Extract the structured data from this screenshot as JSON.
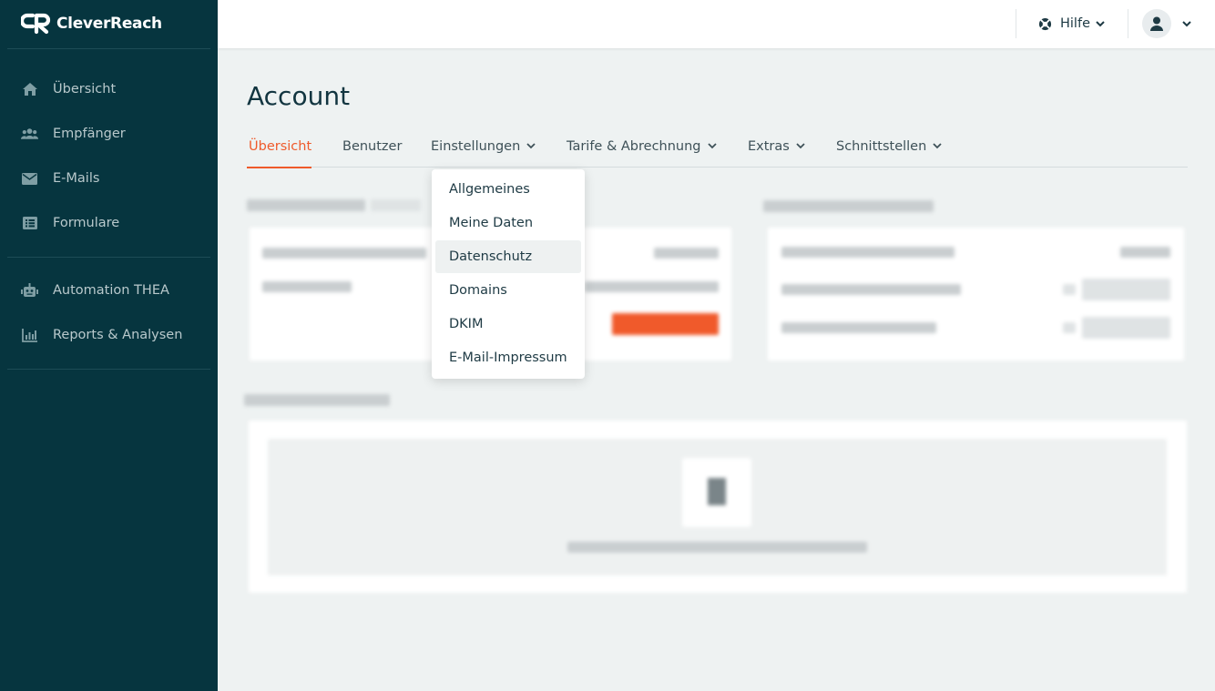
{
  "app": {
    "brand": "CleverReach"
  },
  "sidebar": {
    "items": [
      {
        "label": "Übersicht",
        "icon": "home-icon"
      },
      {
        "label": "Empfänger",
        "icon": "users-icon"
      },
      {
        "label": "E-Mails",
        "icon": "envelope-icon"
      },
      {
        "label": "Formulare",
        "icon": "form-list-icon"
      },
      {
        "label": "Automation THEA",
        "icon": "robot-icon"
      },
      {
        "label": "Reports & Analysen",
        "icon": "bar-chart-icon"
      }
    ]
  },
  "header": {
    "help_label": "Hilfe",
    "help_icon": "lifebuoy-icon",
    "user_icon": "user-icon"
  },
  "page": {
    "title": "Account",
    "tabs": [
      {
        "label": "Übersicht",
        "active": true,
        "has_dropdown": false
      },
      {
        "label": "Benutzer",
        "active": false,
        "has_dropdown": false
      },
      {
        "label": "Einstellungen",
        "active": false,
        "has_dropdown": true
      },
      {
        "label": "Tarife & Abrechnung",
        "active": false,
        "has_dropdown": true
      },
      {
        "label": "Extras",
        "active": false,
        "has_dropdown": true
      },
      {
        "label": "Schnittstellen",
        "active": false,
        "has_dropdown": true
      }
    ]
  },
  "dropdown": {
    "items": [
      {
        "label": "Allgemeines"
      },
      {
        "label": "Meine Daten"
      },
      {
        "label": "Datenschutz",
        "hovered": true
      },
      {
        "label": "Domains"
      },
      {
        "label": "DKIM"
      },
      {
        "label": "E-Mail-Impressum"
      }
    ]
  },
  "colors": {
    "sidebar_bg": "#06353f",
    "accent": "#ef5a2b",
    "page_bg": "#eef2f2"
  }
}
